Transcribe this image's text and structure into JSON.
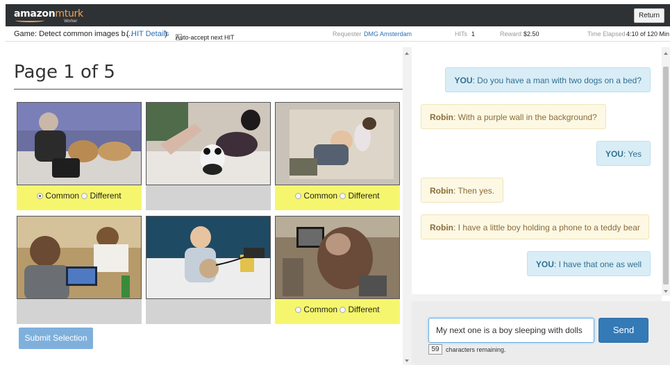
{
  "brand": {
    "name": "amazon",
    "product": "mturk",
    "sub": "Worker"
  },
  "topbar": {
    "return_label": "Return"
  },
  "hit": {
    "title": "Game: Detect common images b…",
    "details_open": "(",
    "details_link": "HIT Details",
    "details_close": ")",
    "auto_accept_label": "Auto-accept next HIT",
    "requester_label": "Requester",
    "requester_name": "DMG Amsterdam",
    "hits_label": "HITs",
    "hits_value": "1",
    "reward_label": "Reward",
    "reward_value": "$2.50",
    "time_label": "Time Elapsed",
    "time_value": "4:10 of 120 Min"
  },
  "game": {
    "page_title": "Page 1 of 5",
    "common_label": "Common",
    "different_label": "Different",
    "submit_label": "Submit Selection",
    "images": [
      {
        "description": "woman on bed with two dogs",
        "choice_visible": true,
        "selected": "common"
      },
      {
        "description": "woman lying on bed with panda teddy bear",
        "choice_visible": false,
        "selected": null
      },
      {
        "description": "boy sleeping with dolls",
        "choice_visible": true,
        "selected": null
      },
      {
        "description": "woman using laptop",
        "choice_visible": false,
        "selected": null
      },
      {
        "description": "boy holding phone and teddy bear",
        "choice_visible": false,
        "selected": null
      },
      {
        "description": "person on bed with laptop",
        "choice_visible": true,
        "selected": null
      }
    ]
  },
  "chat": {
    "messages": [
      {
        "speaker": "YOU",
        "text": ": Do you have a man with two dogs on a bed?",
        "side": "right"
      },
      {
        "speaker": "Robin",
        "text": ": With a purple wall in the background?",
        "side": "left"
      },
      {
        "speaker": "YOU",
        "text": ": Yes",
        "side": "right"
      },
      {
        "speaker": "Robin",
        "text": ": Then yes.",
        "side": "left"
      },
      {
        "speaker": "Robin",
        "text": ": I have a little boy holding a phone to a teddy bear",
        "side": "left"
      },
      {
        "speaker": "YOU",
        "text": ": I have that one as well",
        "side": "right"
      }
    ],
    "input_value": "My next one is a boy sleeping with dolls",
    "send_label": "Send",
    "chars_remaining": "59",
    "chars_remaining_label": "characters remaining."
  },
  "colors": {
    "topbar": "#2f3235",
    "accent": "#f0a35a",
    "choice_bg": "#f6f66e",
    "you_bg": "#d9edf7",
    "robin_bg": "#fcf8e3",
    "send": "#337ab7"
  }
}
